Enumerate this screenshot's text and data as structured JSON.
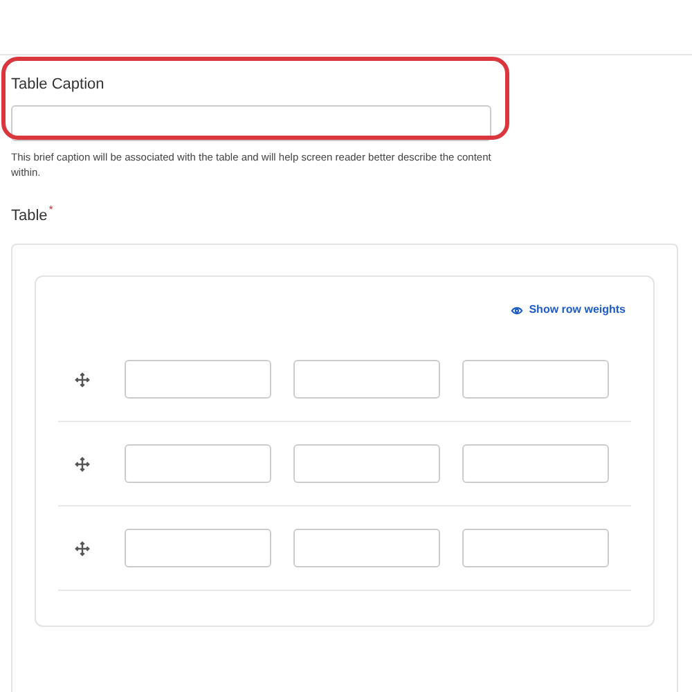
{
  "caption_field": {
    "label": "Table Caption",
    "help": "This brief caption will be associated with the table and will help screen reader better describe the content within."
  },
  "table_field": {
    "label": "Table",
    "required": true,
    "required_mark": "*",
    "toggle_link": "Show row weights",
    "rows": [
      {
        "cells": [
          {
            "kind": "text-input"
          },
          {
            "kind": "text-input"
          },
          {
            "kind": "text-input"
          }
        ]
      },
      {
        "cells": [
          {
            "kind": "text-input"
          },
          {
            "kind": "text-input"
          },
          {
            "kind": "text-input"
          }
        ]
      },
      {
        "cells": [
          {
            "kind": "text-input"
          },
          {
            "kind": "text-input"
          },
          {
            "kind": "text-input"
          }
        ]
      }
    ]
  }
}
